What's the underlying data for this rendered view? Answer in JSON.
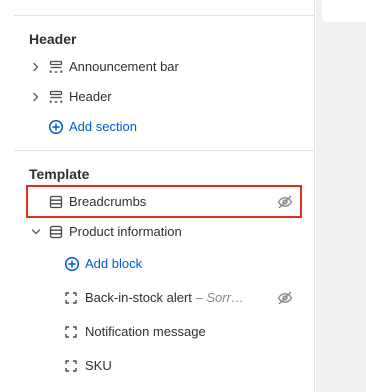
{
  "sidebar": {
    "header_group": {
      "title": "Header",
      "items": [
        {
          "label": "Announcement bar",
          "icon": "section-icon"
        },
        {
          "label": "Header",
          "icon": "section-icon"
        }
      ],
      "add_label": "Add section"
    },
    "template_group": {
      "title": "Template",
      "breadcrumbs_label": "Breadcrumbs",
      "product_info_label": "Product information",
      "add_block_label": "Add block",
      "blocks": [
        {
          "label": "Back-in-stock alert",
          "sub": " – Sorr…"
        },
        {
          "label": "Notification message"
        },
        {
          "label": "SKU"
        }
      ]
    }
  },
  "colors": {
    "accent": "#005bd3",
    "highlight": "#e12f1a",
    "text": "#303030",
    "muted": "#8a8a8a"
  }
}
